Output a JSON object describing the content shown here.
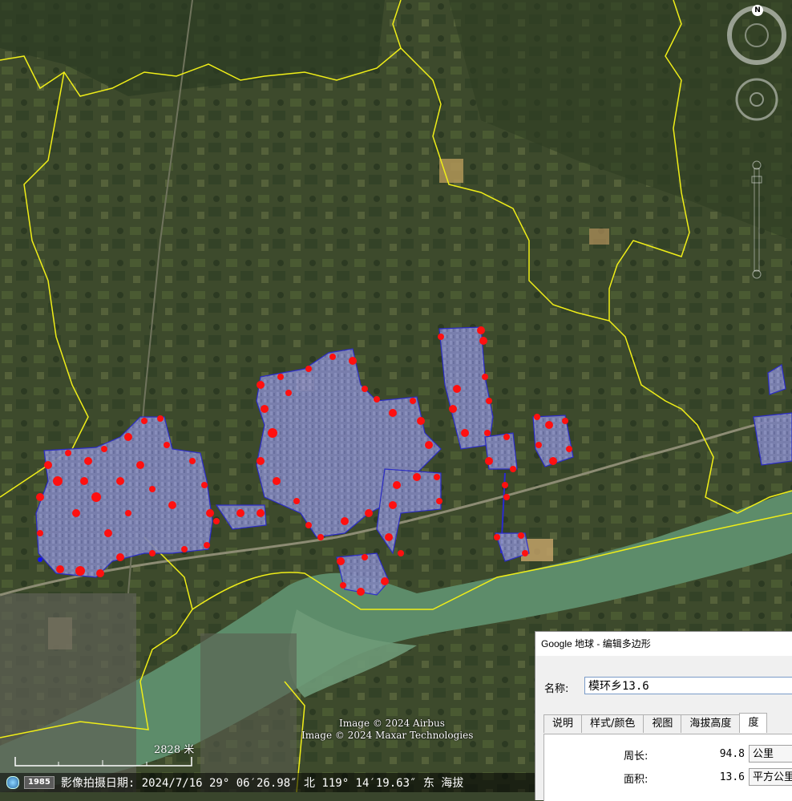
{
  "credits": {
    "line1": "Image © 2024 Airbus",
    "line2": "Image © 2024 Maxar Technologies"
  },
  "scale": {
    "label": "2828 米"
  },
  "status_bar": {
    "year": "1985",
    "text": "影像拍摄日期: 2024/7/16   29° 06′26.98″ 北 119° 14′19.63″ 东 海拔"
  },
  "compass": {
    "north_label": "N"
  },
  "dialog": {
    "title": "Google 地球 - 编辑多边形",
    "name_label": "名称:",
    "name_value": "模环乡13.6",
    "tabs": [
      {
        "label": "说明"
      },
      {
        "label": "样式/颜色"
      },
      {
        "label": "视图"
      },
      {
        "label": "海拔高度"
      },
      {
        "label": "度"
      }
    ],
    "active_tab": "度",
    "measurements": {
      "perimeter_label": "周长:",
      "perimeter_value": "94.8",
      "perimeter_unit": "公里",
      "area_label": "面积:",
      "area_value": "13.6",
      "area_unit": "平方公里"
    }
  },
  "colors": {
    "boundary": "#f0ee18",
    "polygon_fill": "#6670cc",
    "polygon_stroke": "#2a2ad0",
    "vertex": "#ff1010",
    "river": "#5d8c6a"
  }
}
